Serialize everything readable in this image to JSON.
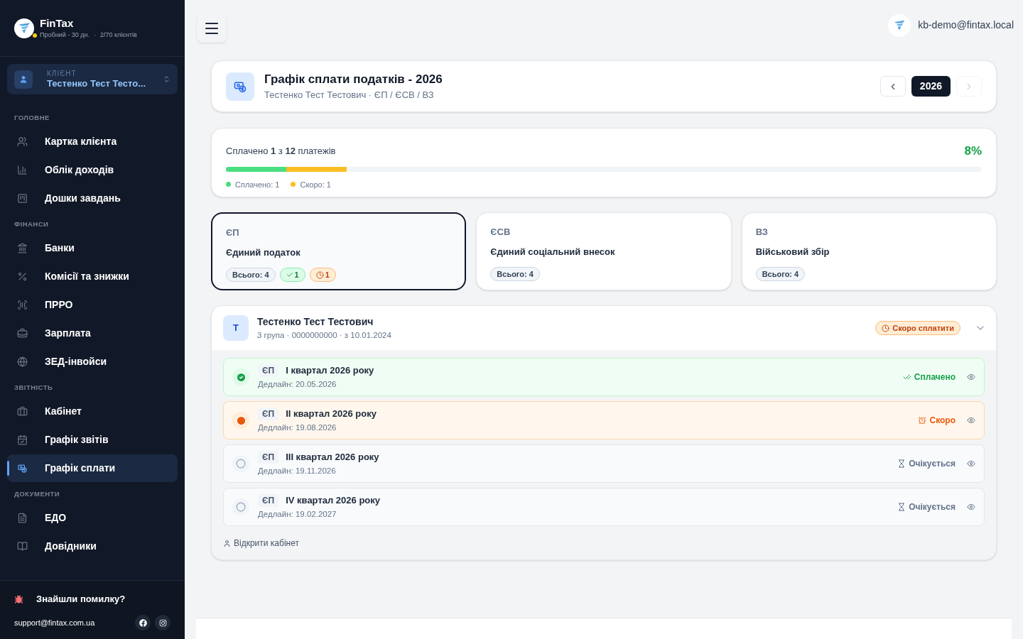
{
  "brand": {
    "name": "FinTax",
    "plan": "Пробний - 30 дн.",
    "separator": "·",
    "clients": "2/70 клієнтів"
  },
  "client_picker": {
    "label": "КЛІЄНТ",
    "value": "Тестенко Тест Тесто..."
  },
  "nav_sections": [
    {
      "title": "ГОЛОВНЕ",
      "items": [
        {
          "label": "Картка клієнта",
          "selected": false
        },
        {
          "label": "Облік доходів",
          "selected": false
        },
        {
          "label": "Дошки завдань",
          "selected": false
        }
      ]
    },
    {
      "title": "ФІНАНСИ",
      "items": [
        {
          "label": "Банки",
          "selected": false
        },
        {
          "label": "Комісії та знижки",
          "selected": false
        },
        {
          "label": "ПРРО",
          "selected": false
        },
        {
          "label": "Зарплата",
          "selected": false
        },
        {
          "label": "ЗЕД-інвойси",
          "selected": false
        }
      ]
    },
    {
      "title": "ЗВІТНІСТЬ",
      "items": [
        {
          "label": "Кабінет",
          "selected": false
        },
        {
          "label": "Графік звітів",
          "selected": false
        },
        {
          "label": "Графік сплати",
          "selected": true
        }
      ]
    },
    {
      "title": "ДОКУМЕНТИ",
      "items": [
        {
          "label": "ЕДО",
          "selected": false
        },
        {
          "label": "Довідники",
          "selected": false
        }
      ]
    }
  ],
  "sidebar_footer": {
    "bug_report": "Знайшли помилку?",
    "email": "support@fintax.com.ua"
  },
  "user": {
    "email": "kb-demo@fintax.local"
  },
  "header": {
    "title": "Графік сплати податків - 2026",
    "subtitle": "Тестенко Тест Тестович · ЄП / ЄСВ / ВЗ",
    "year": "2026"
  },
  "progress": {
    "summary": "Сплачено **1** з **12** платежів",
    "percent": "8%",
    "segments": [
      {
        "label": "Сплачено: 1",
        "level": 0.08,
        "color": "#4ade80"
      },
      {
        "label": "Скоро: 1",
        "level": 0.08,
        "color": "#fbbf24"
      }
    ]
  },
  "tax_cards": [
    {
      "code": "ЄП",
      "name": "Єдиний податок",
      "selected": true,
      "badges": [
        {
          "kind": "total",
          "text": "Всього: 4"
        },
        {
          "kind": "paid",
          "text": "1"
        },
        {
          "kind": "soon",
          "text": "1"
        }
      ]
    },
    {
      "code": "ЄСВ",
      "name": "Єдиний соціальний внесок",
      "selected": false,
      "badges": [
        {
          "kind": "total",
          "text": "Всього: 4"
        }
      ]
    },
    {
      "code": "ВЗ",
      "name": "Військовий збір",
      "selected": false,
      "badges": [
        {
          "kind": "total",
          "text": "Всього: 4"
        }
      ]
    }
  ],
  "client": {
    "initial": "Т",
    "name": "Тестенко Тест Тестович",
    "details": "3 група · 0000000000 · з 10.01.2024",
    "status": "Скоро сплатити",
    "expanded": true,
    "payments": [
      {
        "code": "ЄП",
        "period": "I квартал 2026 року",
        "deadline": "Дедлайн: 20.05.2026",
        "kind": "paid",
        "status": "Сплачено"
      },
      {
        "code": "ЄП",
        "period": "II квартал 2026 року",
        "deadline": "Дедлайн: 19.08.2026",
        "kind": "soon",
        "status": "Скоро"
      },
      {
        "code": "ЄП",
        "period": "III квартал 2026 року",
        "deadline": "Дедлайн: 19.11.2026",
        "kind": "pending",
        "status": "Очікується"
      },
      {
        "code": "ЄП",
        "period": "IV квартал 2026 року",
        "deadline": "Дедлайн: 19.02.2027",
        "kind": "pending",
        "status": "Очікується"
      }
    ],
    "open_link": "Відкрити кабінет"
  }
}
